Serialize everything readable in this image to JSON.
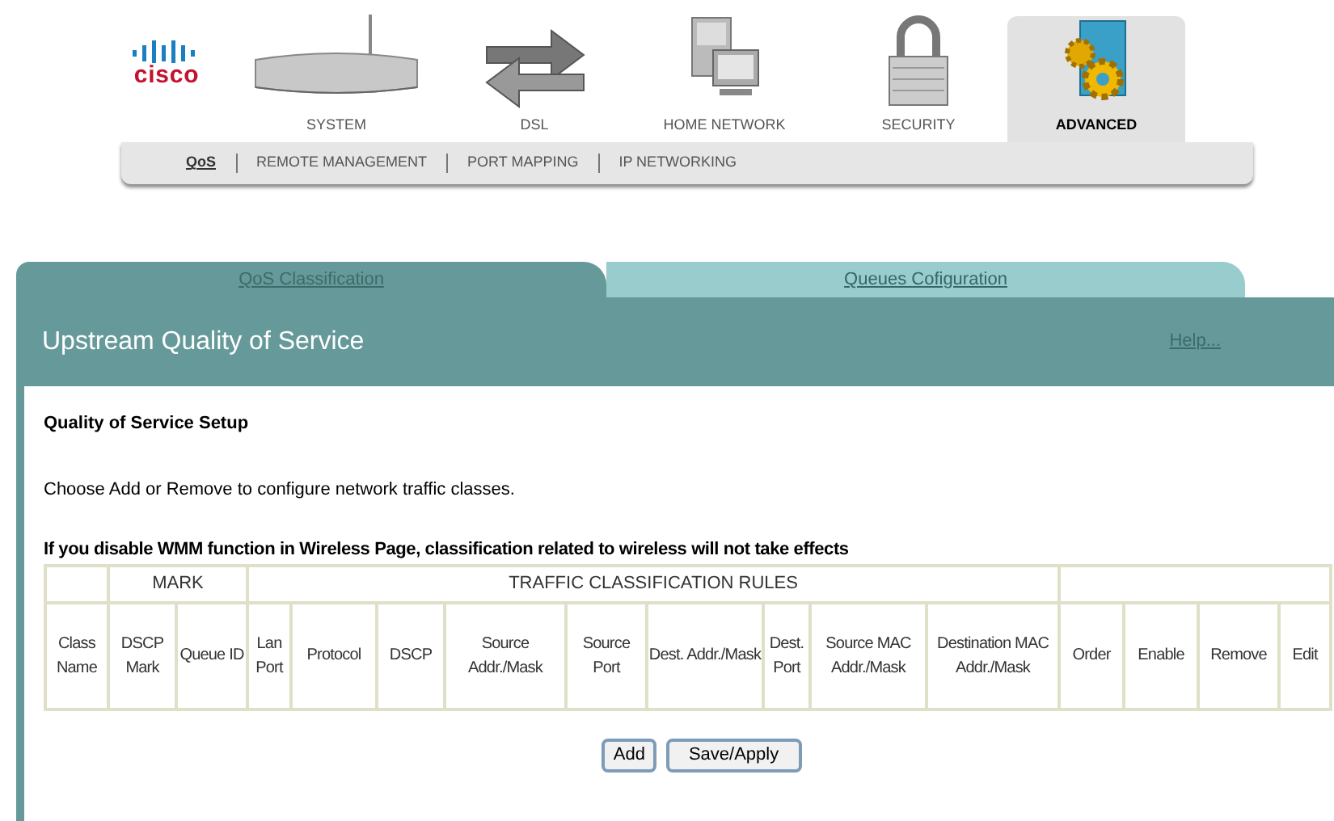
{
  "logo": {
    "text": "cisco"
  },
  "nav": [
    {
      "label": "SYSTEM",
      "kind": "router",
      "selected": false
    },
    {
      "label": "DSL",
      "kind": "arrows",
      "selected": false
    },
    {
      "label": "HOME NETWORK",
      "kind": "computers",
      "selected": false
    },
    {
      "label": "SECURITY",
      "kind": "lock",
      "selected": false
    },
    {
      "label": "ADVANCED",
      "kind": "gears",
      "selected": true
    }
  ],
  "subnav": [
    {
      "label": "QoS",
      "selected": true
    },
    {
      "label": "REMOTE MANAGEMENT",
      "selected": false
    },
    {
      "label": "PORT MAPPING",
      "selected": false
    },
    {
      "label": "IP NETWORKING",
      "selected": false
    }
  ],
  "tabs": [
    {
      "label": "QoS Classification",
      "selected": true
    },
    {
      "label": "Queues Cofiguration",
      "selected": false
    }
  ],
  "panel": {
    "title": "Upstream Quality of Service",
    "help": "Help..."
  },
  "heading": "Quality of Service Setup",
  "intro": "Choose Add or Remove to configure network traffic classes.",
  "warning": "If you disable WMM function in Wireless Page, classification related to wireless will not take effects",
  "table": {
    "groups": [
      {
        "columns": [
          "Class Name"
        ]
      },
      {
        "label": "MARK",
        "columns": [
          "DSCP Mark",
          "Queue ID"
        ]
      },
      {
        "label": "TRAFFIC CLASSIFICATION RULES",
        "columns": [
          "Lan Port",
          "Protocol",
          "DSCP",
          "Source Addr./Mask",
          "Source Port",
          "Dest. Addr./Mask",
          "Dest. Port",
          "Source MAC Addr./Mask",
          "Destination MAC Addr./Mask"
        ]
      },
      {
        "columns": [
          "Order",
          "Enable",
          "Remove",
          "Edit"
        ]
      }
    ]
  },
  "buttons": [
    "Add",
    "Save/Apply"
  ]
}
